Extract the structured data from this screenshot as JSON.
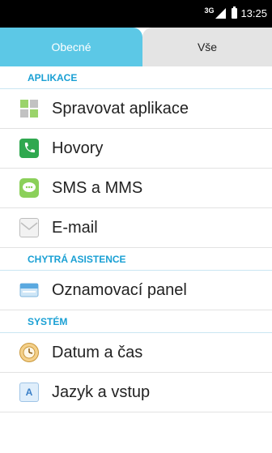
{
  "status_bar": {
    "network": "3G",
    "time": "13:25"
  },
  "tabs": [
    {
      "label": "Obecné",
      "active": true
    },
    {
      "label": "Vše",
      "active": false
    }
  ],
  "sections": [
    {
      "title": "APLIKACE",
      "items": [
        {
          "label": "Spravovat aplikace",
          "icon": "apps-manager-icon"
        },
        {
          "label": "Hovory",
          "icon": "phone-icon"
        },
        {
          "label": "SMS a MMS",
          "icon": "message-icon"
        },
        {
          "label": "E-mail",
          "icon": "envelope-icon"
        }
      ]
    },
    {
      "title": "CHYTRÁ ASISTENCE",
      "items": [
        {
          "label": "Oznamovací panel",
          "icon": "notification-panel-icon"
        }
      ]
    },
    {
      "title": "SYSTÉM",
      "items": [
        {
          "label": "Datum a čas",
          "icon": "clock-icon"
        },
        {
          "label": "Jazyk a vstup",
          "icon": "language-icon"
        }
      ]
    }
  ],
  "colors": {
    "accent": "#1aa0d4",
    "active_tab": "#5cc8e6"
  }
}
